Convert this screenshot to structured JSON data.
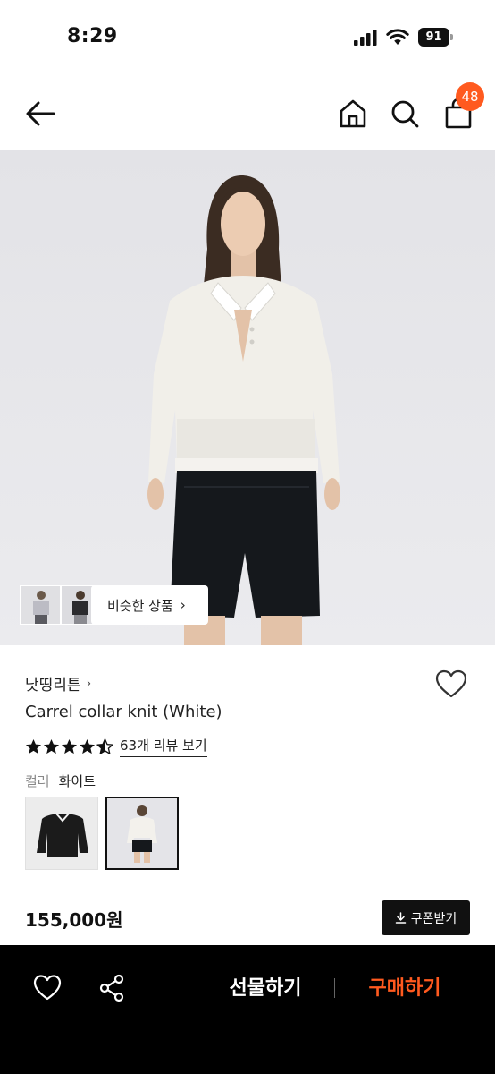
{
  "status_bar": {
    "time": "8:29",
    "battery": "91"
  },
  "header": {
    "cart_count": "48"
  },
  "hero": {
    "similar_label": "비슷한 상품"
  },
  "product": {
    "brand": "낫띵리튼",
    "title": "Carrel collar knit (White)",
    "rating": 4.5,
    "review_link": "63개 리뷰 보기",
    "color_label": "컬러",
    "color_value": "화이트",
    "price": "155,000원",
    "coupon_label": "쿠폰받기"
  },
  "bottom_bar": {
    "gift_label": "선물하기",
    "buy_label": "구매하기"
  },
  "colors": {
    "accent": "#ff5a1f",
    "bottom_bar": "#000000"
  }
}
